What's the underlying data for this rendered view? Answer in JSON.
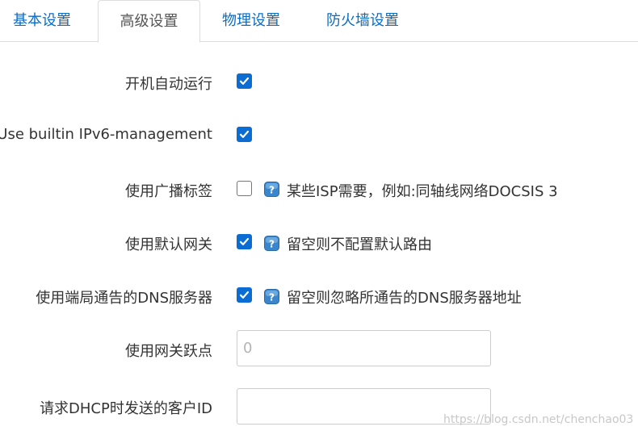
{
  "tabs": [
    {
      "label": "基本设置",
      "active": false
    },
    {
      "label": "高级设置",
      "active": true
    },
    {
      "label": "物理设置",
      "active": false
    },
    {
      "label": "防火墙设置",
      "active": false
    }
  ],
  "form": {
    "rows": [
      {
        "label": "开机自动运行",
        "checked": true
      },
      {
        "label": "Use builtin IPv6-management",
        "checked": true
      },
      {
        "label": "使用广播标签",
        "checked": false,
        "hint": "某些ISP需要，例如:同轴线网络DOCSIS 3"
      },
      {
        "label": "使用默认网关",
        "checked": true,
        "hint": "留空则不配置默认路由"
      },
      {
        "label": "使用端局通告的DNS服务器",
        "checked": true,
        "hint": "留空则忽略所通告的DNS服务器地址"
      },
      {
        "label": "使用网关跃点",
        "input_value": "",
        "placeholder": "0"
      },
      {
        "label": "请求DHCP时发送的客户ID",
        "input_value": "",
        "placeholder": ""
      }
    ]
  },
  "watermark": "https://blog.csdn.net/chenchao03",
  "colors": {
    "link": "#0b6cc6",
    "checkbox": "#0b6cd3",
    "help_icon": "#3a86cc"
  }
}
